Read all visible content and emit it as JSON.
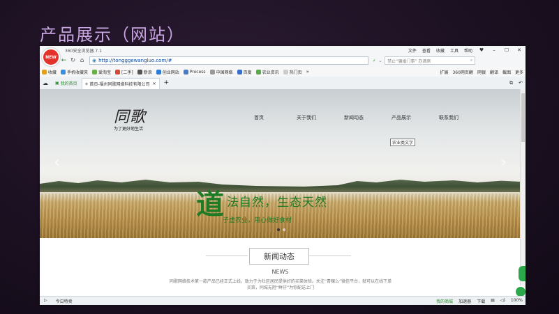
{
  "slide": {
    "title": "产品展示（网站）"
  },
  "browser": {
    "logo_badge": "NEW",
    "app_title": "360安全浏览器 7.1",
    "menu": [
      "文件",
      "查看",
      "收藏",
      "工具",
      "帮助"
    ],
    "window_controls": [
      "♥",
      "–",
      "☐",
      "✕"
    ],
    "url": "http://tongggewangluo.com/#",
    "search_placeholder": "禁止“骗婚门事”  办酒席"
  },
  "favorites": [
    "收藏",
    "手机收藏夹",
    "爱淘宝",
    "[二手]",
    "新浪",
    "创业网站",
    "Process",
    "中国网络",
    "百度",
    "农业资讯",
    "热门页"
  ],
  "favorites_right": [
    "扩展",
    "360网页翻",
    "网银",
    "翻译",
    "截图",
    "更多"
  ],
  "favorite_colors": [
    "#e0a020",
    "#3a8ee0",
    "#6ab04a",
    "#d24a3a",
    "#555555",
    "#2d7bd6",
    "#4a7ac8",
    "#999999",
    "#3a6ec8",
    "#5aa84a",
    "#cccccc"
  ],
  "tabs": [
    {
      "label": "我的首页",
      "type": "home"
    },
    {
      "label": "首页-福州同歌网络科技有限公司",
      "type": "active"
    }
  ],
  "site": {
    "logo_text": "同歌",
    "logo_sub": "为了更好地生活",
    "nav": [
      "首页",
      "关于我们",
      "新闻动态",
      "产品展示",
      "联系我们"
    ],
    "tooltip": "农业类文字",
    "slogan_mark": "道",
    "slogan_main": "法自然，生态天然",
    "slogan_sub": "子虚农业，用心做好食材",
    "news_title": "新闻动态",
    "news_en": "NEWS",
    "news_desc": "同歌网络技术第一款产品已经正式上线，致力于为社区居民提供好的买菜体验。关注“青稞么”微信平台，就可以在线下单买菜，同城无阻“鲜仔”为你配送上门"
  },
  "statusbar": {
    "left": [
      "今日特卖"
    ],
    "right": [
      "我的商城",
      "加速器",
      "下载",
      "",
      "",
      ""
    ],
    "zoom": "100%"
  }
}
